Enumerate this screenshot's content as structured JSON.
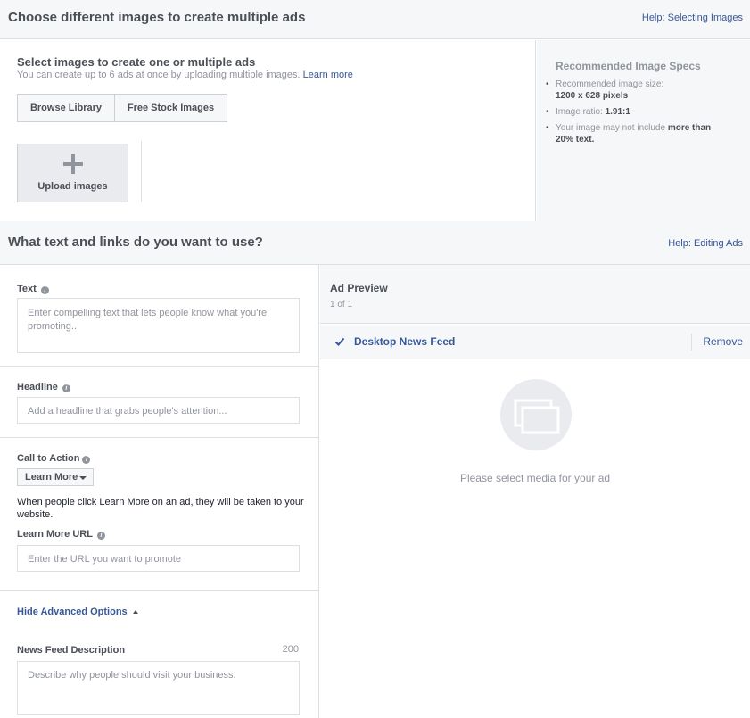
{
  "section1": {
    "title": "Choose different images to create multiple ads",
    "help": "Help: Selecting Images",
    "select_title": "Select images to create one or multiple ads",
    "select_sub": "You can create up to 6 ads at once by uploading multiple images.",
    "learn_more": "Learn more",
    "browse_library": "Browse Library",
    "free_stock": "Free Stock Images",
    "upload_label": "Upload images"
  },
  "specs": {
    "title": "Recommended Image Specs",
    "size_label": "Recommended image size:",
    "size_value": "1200 x 628 pixels",
    "ratio_label": "Image ratio:",
    "ratio_value": "1.91:1",
    "text_label": "Your image may not include",
    "text_value_1": "more than",
    "text_value_2": "20% text."
  },
  "section2": {
    "title": "What text and links do you want to use?",
    "help": "Help: Editing Ads"
  },
  "form": {
    "text_label": "Text",
    "text_placeholder": "Enter compelling text that lets people know what you're promoting...",
    "headline_label": "Headline",
    "headline_placeholder": "Add a headline that grabs people's attention...",
    "cta_label": "Call to Action",
    "cta_value": "Learn More",
    "cta_description": "When people click Learn More on an ad, they will be taken to your website.",
    "url_label": "Learn More URL",
    "url_placeholder": "Enter the URL you want to promote",
    "advanced_toggle": "Hide Advanced Options",
    "nf_desc_label": "News Feed Description",
    "nf_desc_count": "200",
    "nf_desc_placeholder": "Describe why people should visit your business."
  },
  "preview": {
    "title": "Ad Preview",
    "pager": "1 of 1",
    "placement": "Desktop News Feed",
    "remove": "Remove",
    "empty_message": "Please select media for your ad"
  },
  "colors": {
    "link": "#365899",
    "header_bg": "#f6f7f9",
    "border": "#dddfe2",
    "muted_text": "#90949c"
  },
  "icons": [
    "plus-icon",
    "info-icon",
    "caret-down-icon",
    "caret-up-icon",
    "checkmark-icon",
    "media-placeholder-icon"
  ]
}
